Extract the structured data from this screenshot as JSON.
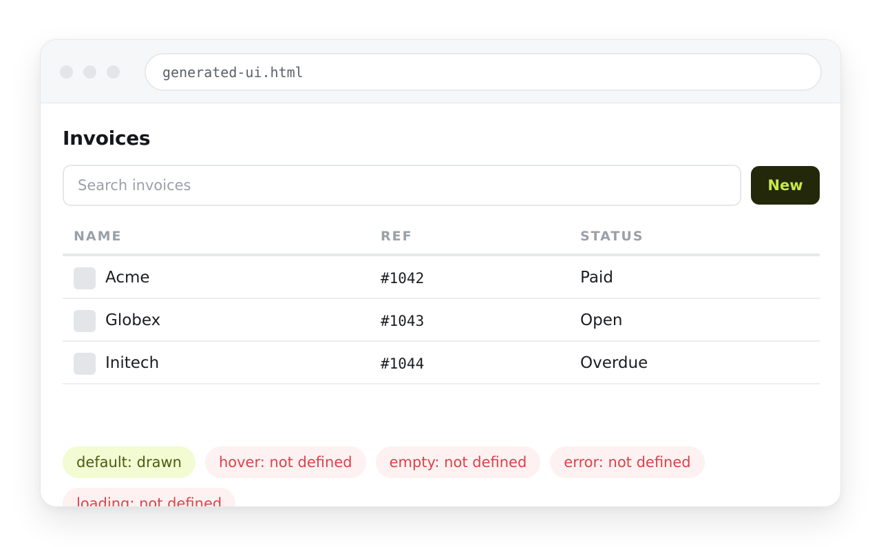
{
  "browser": {
    "url": "generated-ui.html"
  },
  "page": {
    "title": "Invoices"
  },
  "search": {
    "placeholder": "Search invoices",
    "value": ""
  },
  "toolbar": {
    "new_label": "New"
  },
  "table": {
    "columns": [
      "NAME",
      "REF",
      "STATUS"
    ],
    "rows": [
      {
        "name": "Acme",
        "ref": "#1042",
        "status": "Paid"
      },
      {
        "name": "Globex",
        "ref": "#1043",
        "status": "Open"
      },
      {
        "name": "Initech",
        "ref": "#1044",
        "status": "Overdue"
      }
    ]
  },
  "states": [
    {
      "label": "default: drawn",
      "kind": "drawn"
    },
    {
      "label": "hover: not defined",
      "kind": "missing"
    },
    {
      "label": "empty: not defined",
      "kind": "missing"
    },
    {
      "label": "error: not defined",
      "kind": "missing"
    },
    {
      "label": "loading: not defined",
      "kind": "missing"
    }
  ],
  "colors": {
    "accent_bg": "#23280a",
    "accent_text": "#c8e84a",
    "drawn_chip_bg": "#f2fbd2",
    "missing_chip_bg": "#fdf1f1",
    "missing_chip_text": "#d9434b"
  }
}
